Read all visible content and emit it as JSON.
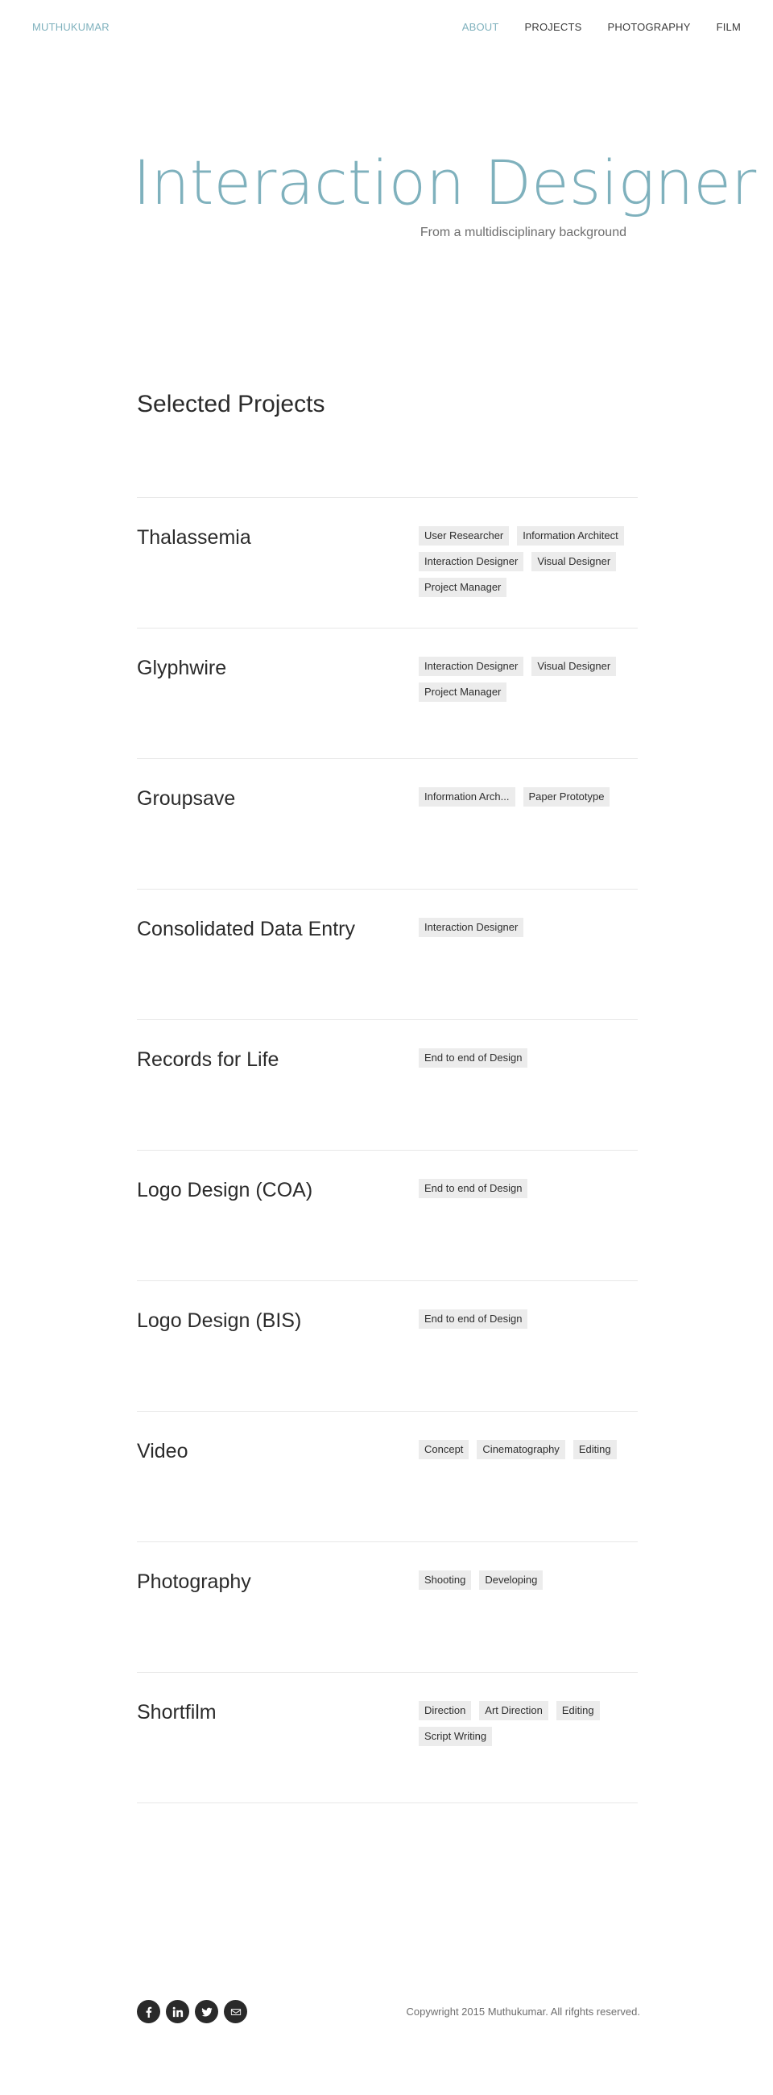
{
  "nav": {
    "brand": "MUTHUKUMAR",
    "items": [
      {
        "label": "ABOUT",
        "active": true
      },
      {
        "label": "PROJECTS",
        "active": false
      },
      {
        "label": "PHOTOGRAPHY",
        "active": false
      },
      {
        "label": "FILM",
        "active": false
      }
    ]
  },
  "hero": {
    "title": "Interaction Designer",
    "subtitle": "From a multidisciplinary background"
  },
  "section_title": "Selected Projects",
  "projects": [
    {
      "title": "Thalassemia",
      "tags": [
        "User Researcher",
        "Information Architect",
        "Interaction Designer",
        "Visual Designer",
        "Project Manager"
      ]
    },
    {
      "title": "Glyphwire",
      "tags": [
        "Interaction Designer",
        "Visual Designer",
        "Project Manager"
      ]
    },
    {
      "title": "Groupsave",
      "tags": [
        "Information Arch...",
        "Paper Prototype"
      ]
    },
    {
      "title": "Consolidated Data Entry",
      "tags": [
        "Interaction Designer"
      ]
    },
    {
      "title": "Records for Life",
      "tags": [
        "End to end of Design"
      ]
    },
    {
      "title": "Logo Design (COA)",
      "tags": [
        "End to end of Design"
      ]
    },
    {
      "title": "Logo Design (BIS)",
      "tags": [
        "End to end of Design"
      ]
    },
    {
      "title": "Video",
      "tags": [
        "Concept",
        "Cinematography",
        "Editing"
      ]
    },
    {
      "title": "Photography",
      "tags": [
        "Shooting",
        "Developing"
      ]
    },
    {
      "title": "Shortfilm",
      "tags": [
        "Direction",
        "Art Direction",
        "Editing",
        "Script Writing"
      ]
    }
  ],
  "footer": {
    "socials": [
      "facebook-icon",
      "linkedin-icon",
      "twitter-icon",
      "mail-icon"
    ],
    "copyright": "Copywright 2015 Muthukumar. All rifghts reserved."
  },
  "colors": {
    "accent": "#7fb1bd",
    "text": "#2b2b2b",
    "tag_bg": "#ececec"
  }
}
